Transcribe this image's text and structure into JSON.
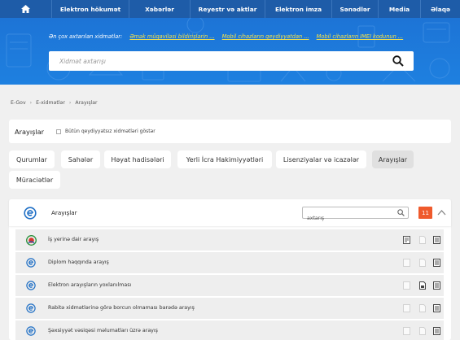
{
  "nav": {
    "items": [
      "Elektron hökumət",
      "Xəbərlər",
      "Reyestr və aktlar",
      "Elektron imza",
      "Sənədlər",
      "Media",
      "Əlaqə"
    ]
  },
  "hero": {
    "popular_label": "Ən çox axtarılan xidmətlər:",
    "popular_links": [
      "Əmək müqaviləsi bildirişlərin ...",
      "Mobil cihazların qeydiyyatdan ...",
      "Mobil cihazların IMEI kodunun ..."
    ],
    "search_placeholder": "Xidmət axtarışı"
  },
  "breadcrumb": [
    "E-Gov",
    "E-xidmətlər",
    "Arayışlar"
  ],
  "header": {
    "title": "Arayışlar",
    "checkbox_label": "Bütün qeydiyyatsız xidmətləri göstər"
  },
  "categories": [
    "Qurumlar",
    "Sahələr",
    "Həyat hadisələri",
    "Yerli İcra Hakimiyyətləri",
    "Lisenziyalar və icazələr",
    "Arayışlar",
    "Müraciətlər"
  ],
  "active_category": "Arayışlar",
  "panel": {
    "title": "Arayışlar",
    "search_placeholder": "axtarış",
    "count": "11",
    "rows": [
      {
        "label": "İş yerinə dair arayış",
        "icon": "ministry-logo-icon"
      },
      {
        "label": "Diplom haqqında arayış",
        "icon": "egov-logo-icon"
      },
      {
        "label": "Elektron arayışların yoxlanılması",
        "icon": "egov-logo-icon"
      },
      {
        "label": "Rabitə xidmətlərinə görə borcun olmaması barədə arayış",
        "icon": "egov-logo-icon"
      },
      {
        "label": "Şəxsiyyət vəsiqəsi məlumatları üzrə arayış",
        "icon": "egov-logo-icon"
      }
    ]
  },
  "colors": {
    "nav": "#1e5ca8",
    "hero": "#1e80e0",
    "link": "#f5e14a",
    "badge": "#ef5a2c"
  }
}
